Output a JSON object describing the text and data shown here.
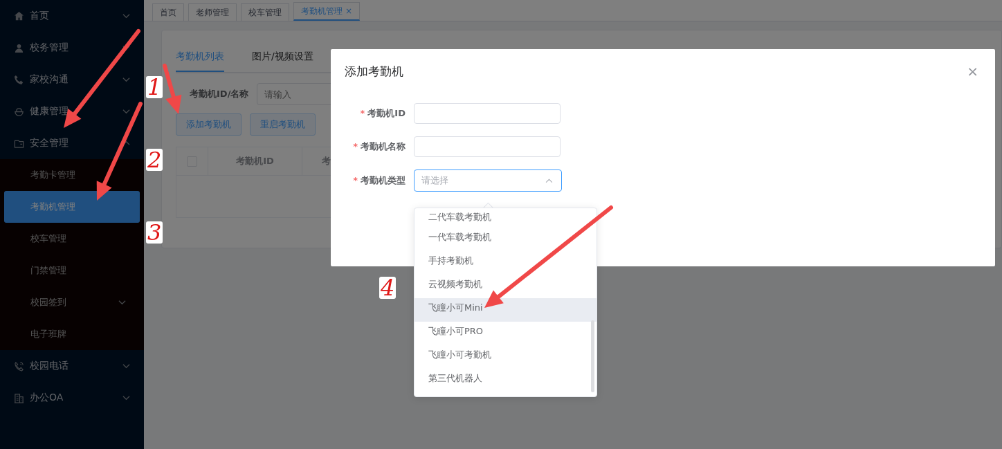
{
  "sidebar": {
    "items": [
      {
        "label": "首页",
        "expanded": false
      },
      {
        "label": "校务管理",
        "expanded": false
      },
      {
        "label": "家校沟通",
        "expanded": false
      },
      {
        "label": "健康管理",
        "expanded": false
      },
      {
        "label": "安全管理",
        "expanded": true,
        "children": [
          {
            "label": "考勤卡管理",
            "kind": "leaf",
            "selected": false
          },
          {
            "label": "考勤机管理",
            "kind": "leaf",
            "selected": true
          },
          {
            "label": "校车管理",
            "kind": "leaf",
            "selected": false
          },
          {
            "label": "门禁管理",
            "kind": "leaf",
            "selected": false
          },
          {
            "label": "校园签到",
            "kind": "group",
            "selected": false
          },
          {
            "label": "电子班牌",
            "kind": "leaf",
            "selected": false
          }
        ]
      },
      {
        "label": "校园电话",
        "expanded": false
      },
      {
        "label": "办公OA",
        "expanded": false
      }
    ]
  },
  "page_tabs": [
    {
      "label": "首页",
      "selected": false
    },
    {
      "label": "老师管理",
      "selected": false
    },
    {
      "label": "校车管理",
      "selected": false
    },
    {
      "label": "考勤机管理",
      "selected": true,
      "close": "×"
    }
  ],
  "card": {
    "tabs": [
      {
        "label": "考勤机列表",
        "selected": true
      },
      {
        "label": "图片/视频设置",
        "selected": false
      }
    ],
    "filter": {
      "label": "考勤机ID/名称",
      "placeholder": "请输入"
    },
    "buttons": [
      "添加考勤机",
      "重启考勤机"
    ],
    "table": {
      "select_all_checked": false,
      "columns": [
        "考勤机ID",
        "考"
      ]
    }
  },
  "dialog": {
    "title": "添加考勤机",
    "close": "×",
    "required_mark": "*",
    "fields": [
      {
        "label": "考勤机ID",
        "required": true,
        "kind": "input"
      },
      {
        "label": "考勤机名称",
        "required": true,
        "kind": "input"
      },
      {
        "label": "考勤机类型",
        "required": true,
        "kind": "select",
        "placeholder": "请选择",
        "expanded": true
      }
    ],
    "options": [
      {
        "label": "二代车载考勤机",
        "hovered": false
      },
      {
        "label": "一代车载考勤机",
        "hovered": false
      },
      {
        "label": "手持考勤机",
        "hovered": false
      },
      {
        "label": "云视频考勤机",
        "hovered": false
      },
      {
        "label": "飞瞳小可Mini",
        "hovered": true
      },
      {
        "label": "飞瞳小可PRO",
        "hovered": false
      },
      {
        "label": "飞瞳小可考勤机",
        "hovered": false
      },
      {
        "label": "第三代机器人",
        "hovered": false
      }
    ]
  },
  "annotations": [
    {
      "label": "1"
    },
    {
      "label": "2"
    },
    {
      "label": "3"
    },
    {
      "label": "4"
    }
  ]
}
